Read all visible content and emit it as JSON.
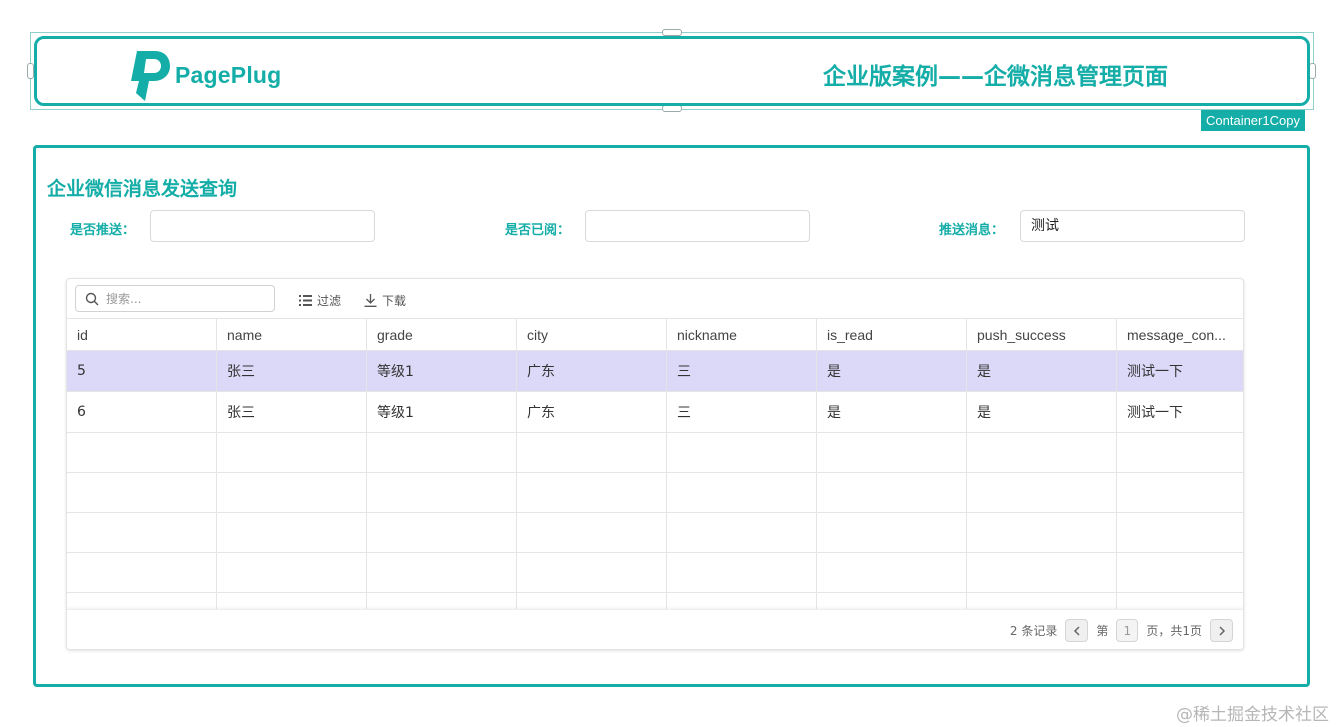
{
  "header": {
    "logo_text": "PagePlug",
    "title": "企业版案例——企微消息管理页面",
    "widget_tag": "Container1Copy",
    "accent_color": "#14ada7"
  },
  "main": {
    "section_title": "企业微信消息发送查询",
    "filters": [
      {
        "label": "是否推送：",
        "value": ""
      },
      {
        "label": "是否已阅：",
        "value": ""
      },
      {
        "label": "推送消息：",
        "value": "测试"
      }
    ]
  },
  "table": {
    "search_placeholder": "搜索...",
    "filter_label": "过滤",
    "download_label": "下载",
    "columns": [
      "id",
      "name",
      "grade",
      "city",
      "nickname",
      "is_read",
      "push_success",
      "message_con..."
    ],
    "rows": [
      [
        "5",
        "张三",
        "等级1",
        "广东",
        "三",
        "是",
        "是",
        "测试一下"
      ],
      [
        "6",
        "张三",
        "等级1",
        "广东",
        "三",
        "是",
        "是",
        "测试一下"
      ]
    ],
    "selected_row_color": "#dcd8f7",
    "footer": {
      "record_count": "2 条记录",
      "page_prefix": "第",
      "current_page": "1",
      "page_suffix": "页，共1页"
    }
  },
  "watermark": "@稀土掘金技术社区"
}
